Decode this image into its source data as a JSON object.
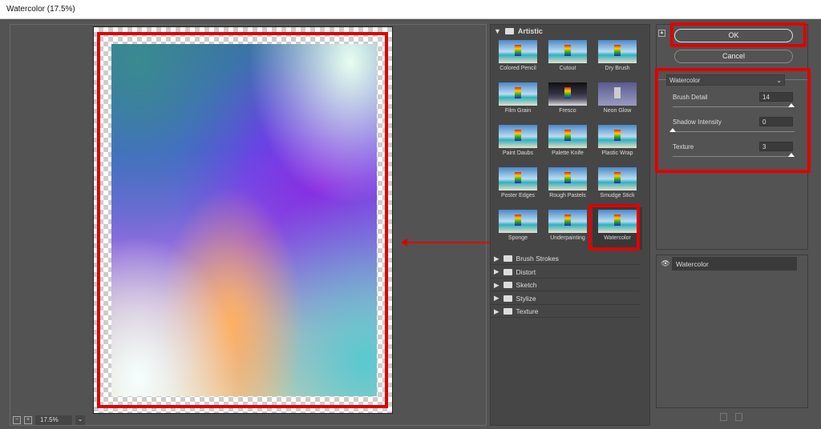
{
  "window": {
    "title": "Watercolor (17.5%)"
  },
  "preview": {
    "zoom": "17.5%",
    "zoom_out_icon": "minus-square-icon",
    "zoom_in_icon": "plus-square-icon"
  },
  "filter_gallery": {
    "categories": [
      {
        "label": "Artistic",
        "expanded": true,
        "filters": [
          "Colored Pencil",
          "Cutout",
          "Dry Brush",
          "Film Grain",
          "Fresco",
          "Neon Glow",
          "Paint Daubs",
          "Palette Knife",
          "Plastic Wrap",
          "Poster Edges",
          "Rough Pastels",
          "Smudge Stick",
          "Sponge",
          "Underpainting",
          "Watercolor"
        ],
        "selected": "Watercolor"
      },
      {
        "label": "Brush Strokes"
      },
      {
        "label": "Distort"
      },
      {
        "label": "Sketch"
      },
      {
        "label": "Stylize"
      },
      {
        "label": "Texture"
      }
    ]
  },
  "settings": {
    "ok_label": "OK",
    "cancel_label": "Cancel",
    "filter": "Watercolor",
    "params": [
      {
        "label": "Brush Detail",
        "value": "14",
        "slider": 1.0
      },
      {
        "label": "Shadow Intensity",
        "value": "0",
        "slider": 0.0
      },
      {
        "label": "Texture",
        "value": "3",
        "slider": 1.0
      }
    ]
  },
  "layers": {
    "items": [
      {
        "label": "Watercolor",
        "visible": true
      }
    ]
  },
  "colors": {
    "highlight": "#e00000",
    "panel": "#535353"
  }
}
